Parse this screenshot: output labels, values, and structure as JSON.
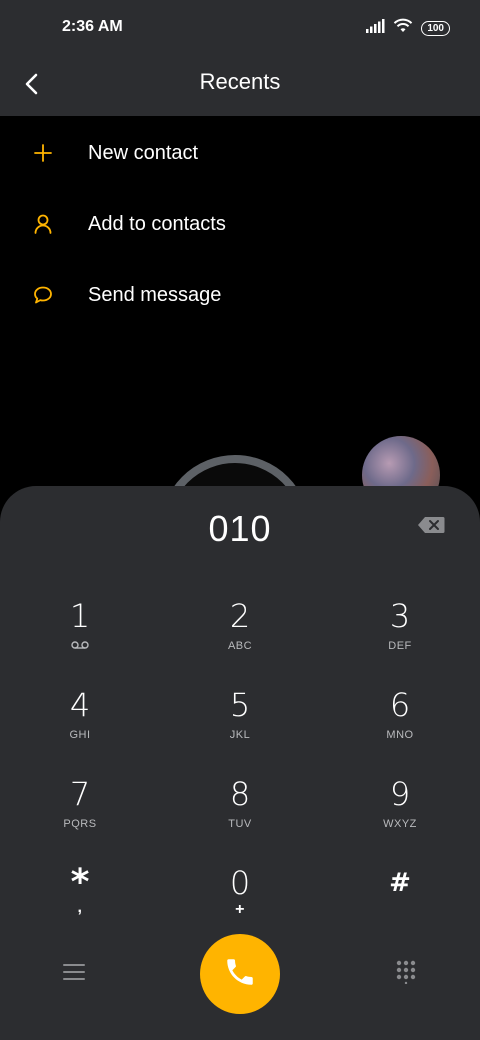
{
  "status": {
    "time": "2:36 AM",
    "battery": "100"
  },
  "header": {
    "title": "Recents"
  },
  "menu": [
    {
      "label": "New contact",
      "icon": "plus-icon"
    },
    {
      "label": "Add to contacts",
      "icon": "person-icon"
    },
    {
      "label": "Send message",
      "icon": "message-icon"
    }
  ],
  "dialer": {
    "number": "010",
    "keys": [
      {
        "digit": "1",
        "letters": ""
      },
      {
        "digit": "2",
        "letters": "ABC"
      },
      {
        "digit": "3",
        "letters": "DEF"
      },
      {
        "digit": "4",
        "letters": "GHI"
      },
      {
        "digit": "5",
        "letters": "JKL"
      },
      {
        "digit": "6",
        "letters": "MNO"
      },
      {
        "digit": "7",
        "letters": "PQRS"
      },
      {
        "digit": "8",
        "letters": "TUV"
      },
      {
        "digit": "9",
        "letters": "WXYZ"
      },
      {
        "digit": "*",
        "letters": ","
      },
      {
        "digit": "0",
        "letters": "+"
      },
      {
        "digit": "#",
        "letters": ""
      }
    ]
  },
  "colors": {
    "accent": "#ffb400",
    "panel": "#2c2d30",
    "background": "#000000"
  }
}
